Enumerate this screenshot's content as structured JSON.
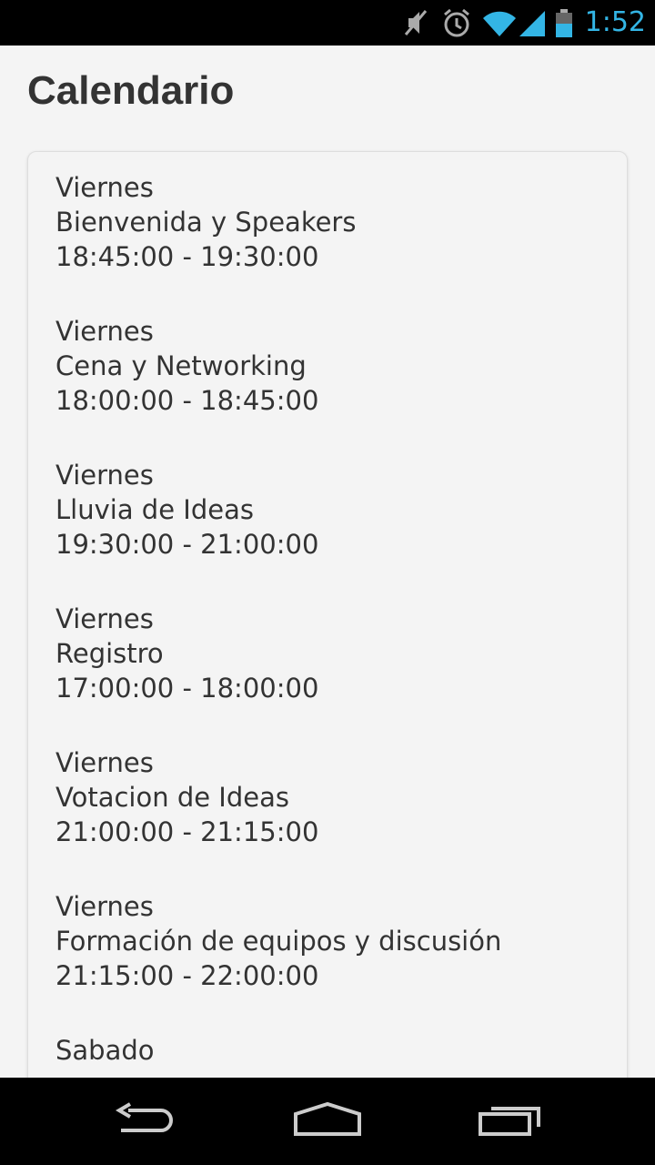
{
  "status_bar": {
    "time": "1:52",
    "icons": [
      "mute-icon",
      "alarm-icon",
      "wifi-icon",
      "signal-icon",
      "battery-icon"
    ],
    "accent_color": "#33b5e5"
  },
  "header": {
    "title": "Calendario"
  },
  "events": [
    {
      "day": "Viernes",
      "name": "Bienvenida y Speakers",
      "time": "18:45:00 - 19:30:00"
    },
    {
      "day": "Viernes",
      "name": "Cena y Networking",
      "time": "18:00:00 - 18:45:00"
    },
    {
      "day": "Viernes",
      "name": "Lluvia de Ideas",
      "time": "19:30:00 - 21:00:00"
    },
    {
      "day": "Viernes",
      "name": "Registro",
      "time": "17:00:00 - 18:00:00"
    },
    {
      "day": "Viernes",
      "name": "Votacion de Ideas",
      "time": "21:00:00 - 21:15:00"
    },
    {
      "day": "Viernes",
      "name": "Formación de equipos y discusión",
      "time": "21:15:00 - 22:00:00"
    },
    {
      "day": "Sabado",
      "name": "",
      "time": ""
    }
  ],
  "nav_bar": {
    "icons": [
      "back-icon",
      "home-icon",
      "recent-apps-icon"
    ]
  }
}
